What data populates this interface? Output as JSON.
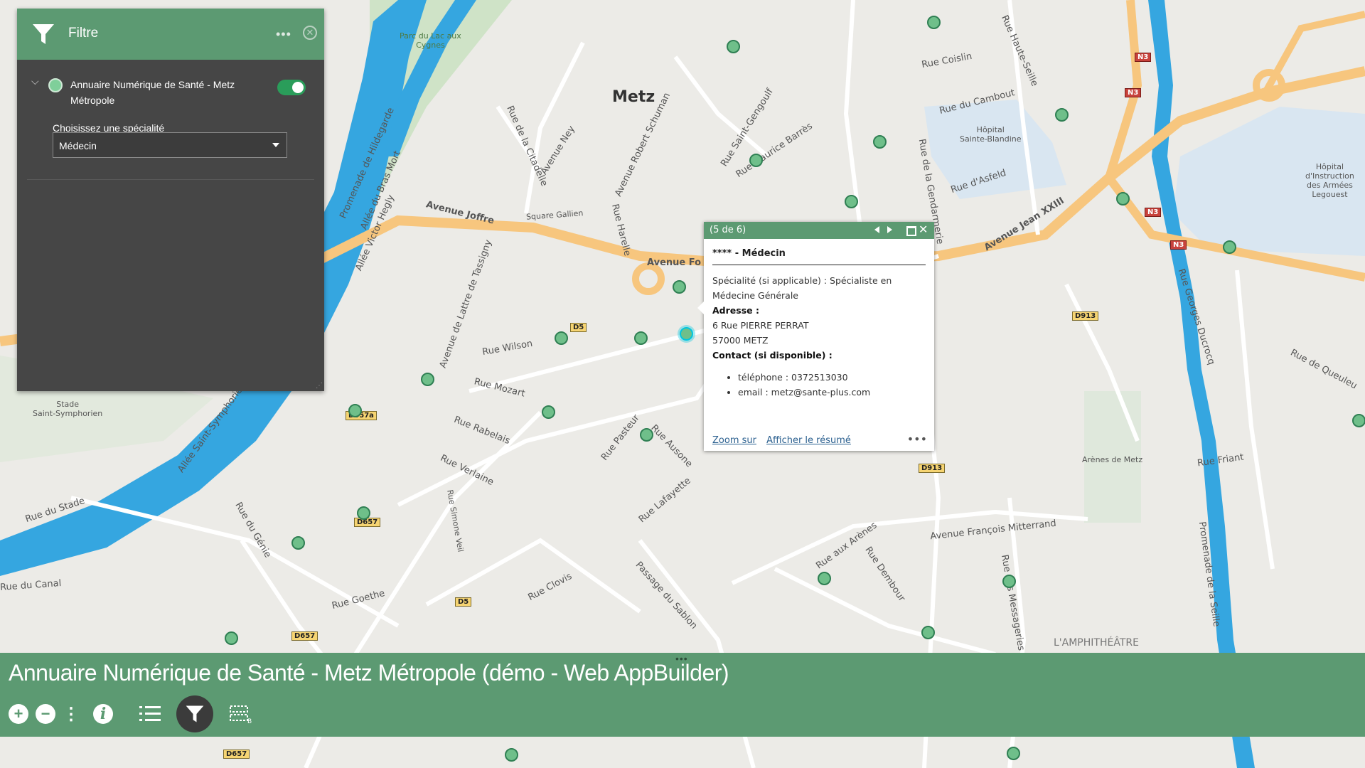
{
  "map": {
    "labels": {
      "metz": "Metz",
      "parc_lac": "Parc du Lac aux\nCygnes",
      "hopital_sainte_blandine": "Hôpital\nSainte-Blandine",
      "hopital_legouest": "Hôpital\nd'Instruction\ndes Armées\nLegouest",
      "stade": "Stade\nSaint-Symphorien",
      "arenes": "Arènes de Metz",
      "amphitheatre": "L'AMPHITHÉÂTRE",
      "avenue_joffre": "Avenue Joffre",
      "avenue_fo": "Avenue Fo",
      "avenue_jean": "Avenue Jean XXIII",
      "rue_wilson": "Rue Wilson",
      "rue_mozart": "Rue Mozart",
      "rue_rabelais": "Rue Rabelais",
      "rue_verlaine": "Rue Verlaine",
      "rue_du_stade": "Rue du Stade",
      "rue_du_canal": "Rue du Canal",
      "rue_goethe": "Rue Goethe",
      "rue_clovis": "Rue Clovis",
      "rue_coislin": "Rue Coislin",
      "rue_cambout": "Rue du Cambout",
      "rue_asfeld": "Rue d'Asfeld",
      "rue_friant": "Rue Friant",
      "av_mitterrand": "Avenue François Mitterrand",
      "rue_aux_arenes": "Rue aux Arènes",
      "rue_lafayette": "Rue Lafayette",
      "rue_pasteur": "Rue Pasteur",
      "square_gallien": "Square Gallien",
      "rue_la_citadelle": "Rue de la Citadelle",
      "avenue_ney": "Avenue Ney",
      "av_schuman": "Avenue Robert Schuman",
      "rue_saint_gengoulf": "Rue Saint-Gengoulf",
      "rue_maurice_barres": "Rue Maurice Barrès",
      "rue_queuleu": "Rue de Queuleu",
      "promenade_hildegarde": "Promenade de Hildegarde",
      "allee_bras_mort": "Allée du Bras Mort",
      "allee_victor_hegly": "Allée Victor Hegly",
      "av_lattre": "Avenue de Lattre de Tassigny",
      "rue_du_genie": "Rue du Génie",
      "rue_simone_veil": "Rue Simone Veil",
      "passage_sablon": "Passage du Sablon",
      "rue_ausone": "Rue Ausone",
      "rue_dembour": "Rue Dembour",
      "rue_des_messageries": "Rue des Messageries",
      "rue_gendarmerie": "Rue de la Gendarmerie",
      "rue_haute_seille": "Rue Haute-Seille",
      "rue_georges_ducrocq": "Rue Georges Ducrocq",
      "rue_harelle": "Rue Harelle",
      "allee_saint_symphorien": "Allée Saint-Symphorien",
      "promenade_seille": "Promenade de la Seille"
    },
    "shields": [
      "N3",
      "N3",
      "N3",
      "N3",
      "D913",
      "D913",
      "D5",
      "D5",
      "D657",
      "D657",
      "D657",
      "D657a"
    ]
  },
  "filter": {
    "title": "Filtre",
    "more": "•••",
    "close": "✕",
    "layer_title": "Annuaire Numérique de Santé - Metz Métropole",
    "layer_enabled": true,
    "select_label": "Choisissez une spécialité",
    "select_value": "Médecin"
  },
  "popup": {
    "count": "(5 de 6)",
    "title": "**** - Médecin",
    "specialite": "Spécialité (si applicable) : Spécialiste en Médecine Générale",
    "adresse_label": "Adresse :",
    "adresse_line1": "6 Rue PIERRE PERRAT",
    "adresse_line2": "57000 METZ",
    "contact_label": "Contact (si disponible) :",
    "telephone": "téléphone : 0372513030",
    "email": "email : metz@sante-plus.com",
    "zoom": "Zoom sur",
    "resume": "Afficher le résumé",
    "more": "•••"
  },
  "app": {
    "title": "Annuaire Numérique de Santé - Metz Métropole (démo - Web AppBuilder)",
    "handle": "•••",
    "toolbar": {
      "zoom_in": "+",
      "zoom_out": "−",
      "more": "⋮",
      "info": "i"
    }
  },
  "colors": {
    "brand_green": "#5c9a72",
    "panel_dark": "#464646",
    "poi_green": "#6fbf8a",
    "water_blue": "#35a6e0",
    "road_orange": "#f7c67e"
  }
}
